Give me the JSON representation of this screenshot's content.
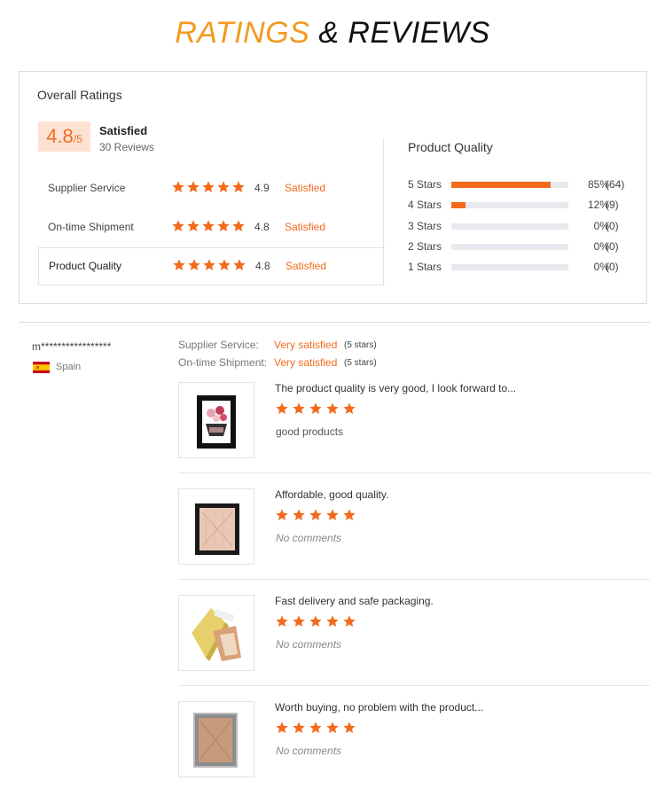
{
  "heading": {
    "part1": "RATINGS",
    "part2": "& REVIEWS"
  },
  "summary": {
    "title": "Overall Ratings",
    "score": "4.8",
    "score_max": "/5",
    "satisfaction": "Satisfied",
    "reviews_count": "30 Reviews",
    "rows": [
      {
        "label": "Supplier Service",
        "stars": 5,
        "value": "4.9",
        "word": "Satisfied"
      },
      {
        "label": "On-time Shipment",
        "stars": 5,
        "value": "4.8",
        "word": "Satisfied"
      },
      {
        "label": "Product Quality",
        "stars": 5,
        "value": "4.8",
        "word": "Satisfied"
      }
    ]
  },
  "product_quality": {
    "title": "Product Quality",
    "distribution": [
      {
        "label": "5  Stars",
        "percent": 85,
        "percent_text": "85%",
        "count": "(64)"
      },
      {
        "label": "4  Stars",
        "percent": 12,
        "percent_text": "12%",
        "count": "(9)"
      },
      {
        "label": "3  Stars",
        "percent": 0,
        "percent_text": "0%",
        "count": "(0)"
      },
      {
        "label": "2  Stars",
        "percent": 0,
        "percent_text": "0%",
        "count": "(0)"
      },
      {
        "label": "1  Stars",
        "percent": 0,
        "percent_text": "0%",
        "count": "(0)"
      }
    ]
  },
  "reviewer": {
    "name": "m*****************",
    "country": "Spain",
    "supplier_service_label": "Supplier Service:",
    "supplier_service_value": "Very satisfied",
    "supplier_service_note": "(5 stars)",
    "shipment_label": "On-time Shipment:",
    "shipment_value": "Very satisfied",
    "shipment_note": "(5 stars)"
  },
  "reviews": [
    {
      "text": "The product quality is very good, I look forward to...",
      "stars": 5,
      "comment": "good products",
      "has_comment": true,
      "thumb": "black-frame-photo"
    },
    {
      "text": "Affordable, good quality.",
      "stars": 5,
      "comment": "No comments",
      "has_comment": false,
      "thumb": "black-frame"
    },
    {
      "text": "Fast delivery and safe packaging.",
      "stars": 5,
      "comment": "No comments",
      "has_comment": false,
      "thumb": "gold-frame-stand"
    },
    {
      "text": "Worth buying, no problem with the product...",
      "stars": 5,
      "comment": "No comments",
      "has_comment": false,
      "thumb": "silver-frame"
    }
  ],
  "colors": {
    "accent": "#f26b1d",
    "title_orange": "#f29a1e",
    "score_bg": "#fde2d3",
    "track": "#e8e8ee"
  }
}
